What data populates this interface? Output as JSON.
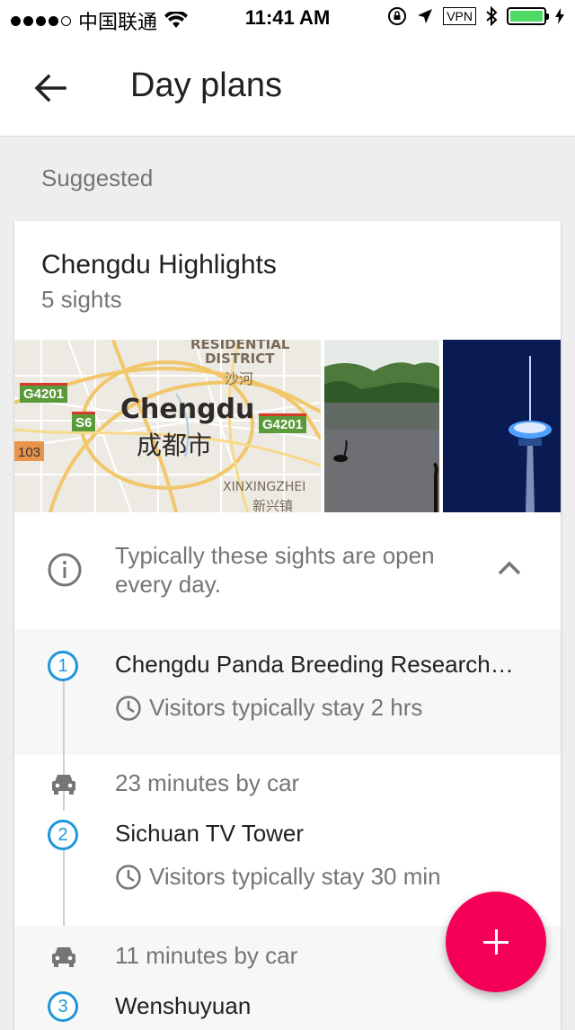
{
  "status_bar": {
    "carrier": "中国联通",
    "time": "11:41 AM",
    "vpn": "VPN"
  },
  "app_bar": {
    "title": "Day plans"
  },
  "section_label": "Suggested",
  "card": {
    "title": "Chengdu Highlights",
    "subtitle": "5 sights",
    "map": {
      "city_en": "Chengdu",
      "city_zh": "成都市",
      "label_residential": "RESIDENTIAL",
      "label_district": "DISTRICT",
      "label_shahe": "沙河",
      "label_xinxing_en": "XINXINGZHEI",
      "label_xinxing_zh": "新兴镇",
      "shield_g4201_a": "G4201",
      "shield_g4201_b": "G4201",
      "shield_s6": "S6",
      "shield_103": "103"
    },
    "info_text": "Typically these sights are open every day.",
    "stops": [
      {
        "number": "1",
        "name": "Chengdu Panda Breeding Research…",
        "stay": "Visitors typically stay 2 hrs"
      },
      {
        "number": "2",
        "name": "Sichuan TV Tower",
        "stay": "Visitors typically stay 30 min"
      },
      {
        "number": "3",
        "name": "Wenshuyuan"
      }
    ],
    "drives": [
      "23 minutes by car",
      "11 minutes by car"
    ]
  },
  "colors": {
    "accent": "#1e96d8",
    "fab": "#f50057"
  }
}
